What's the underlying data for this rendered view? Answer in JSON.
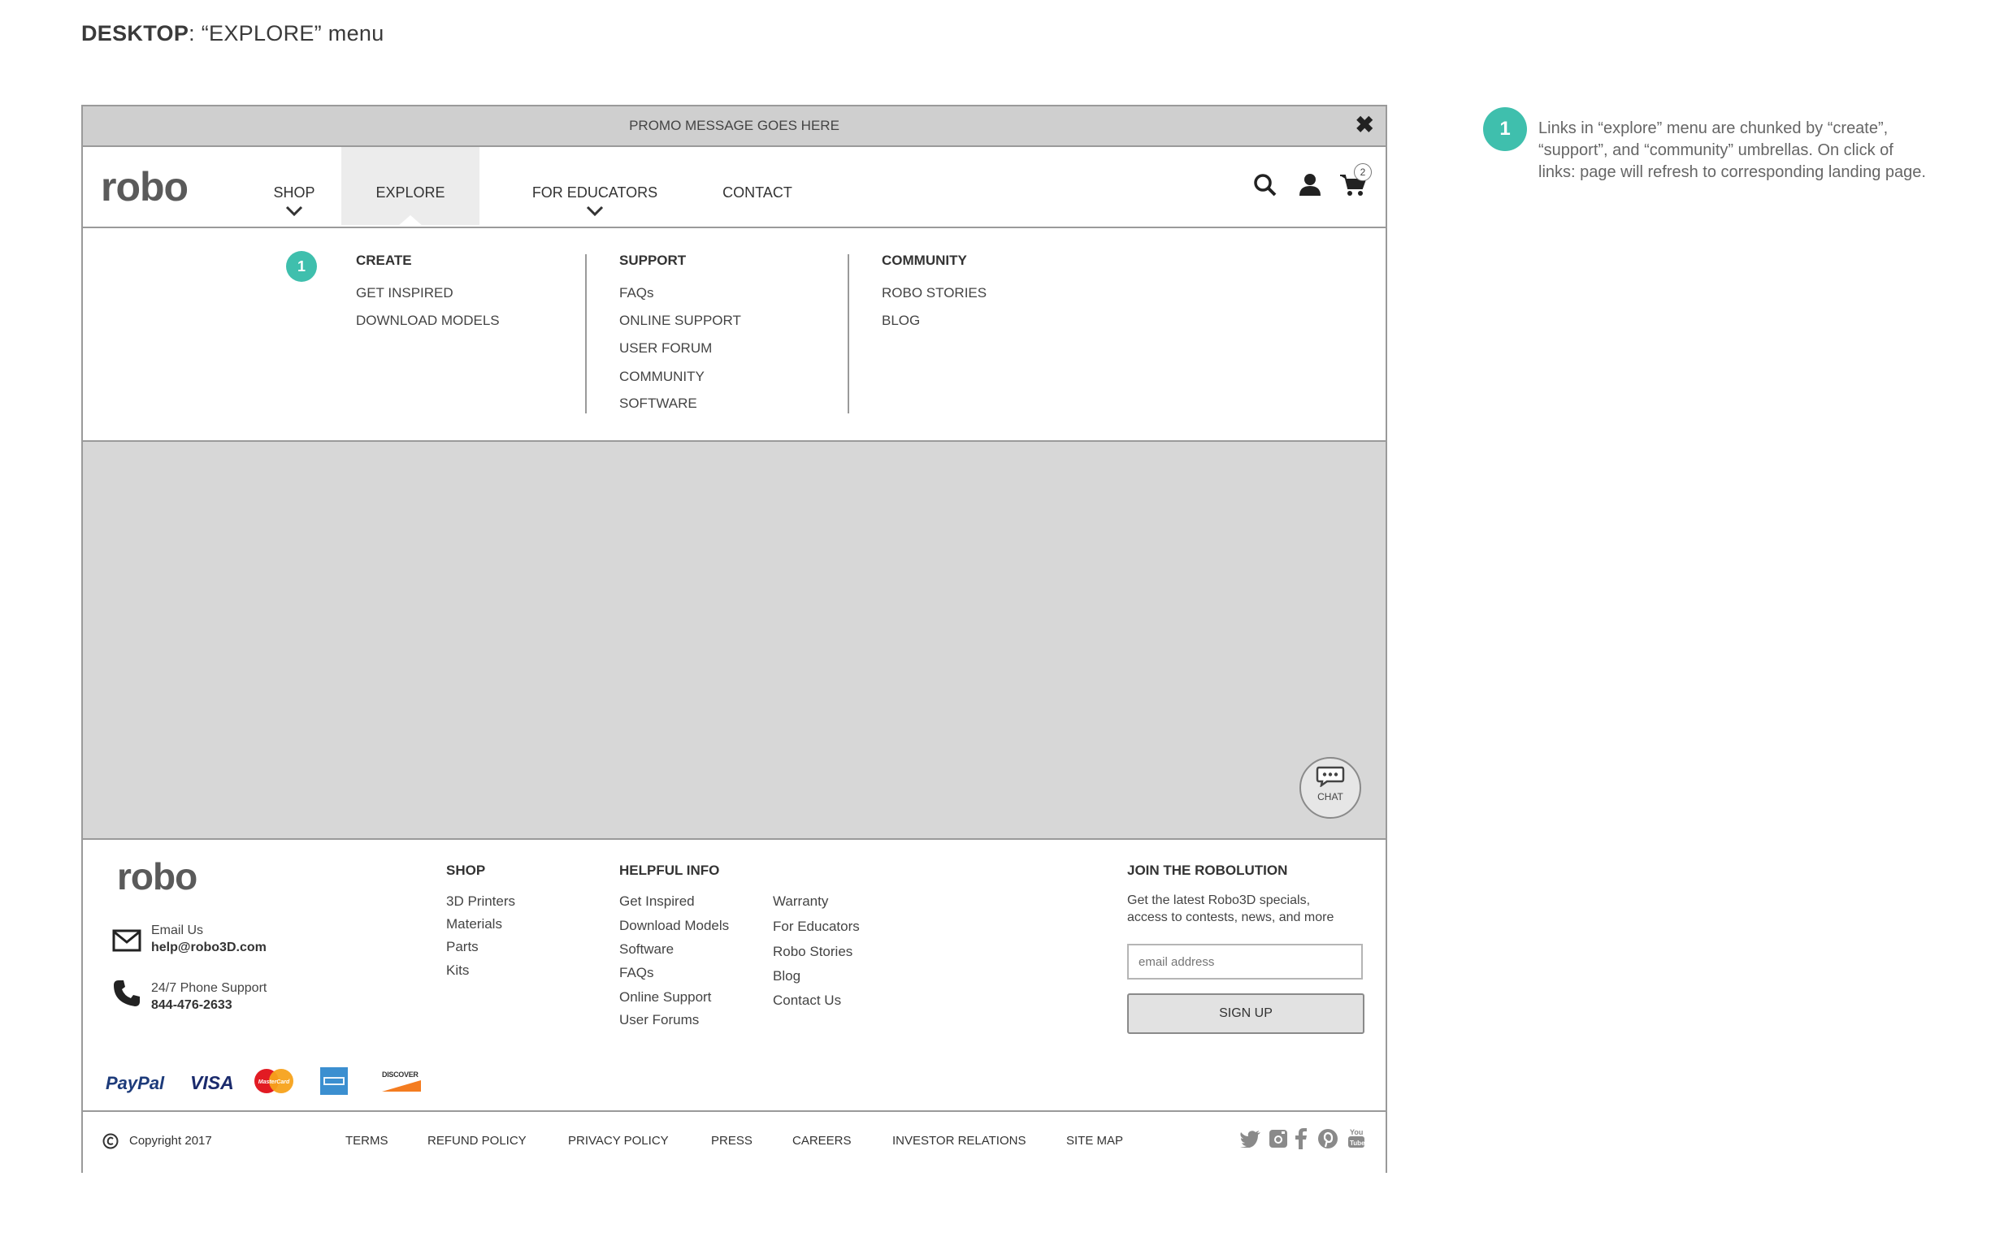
{
  "page": {
    "title_bold": "DESKTOP",
    "title_rest": ": “EXPLORE” menu"
  },
  "promo": {
    "message": "PROMO MESSAGE GOES HERE",
    "close_icon": "close-icon"
  },
  "header": {
    "logo": "robo",
    "nav": [
      {
        "label": "SHOP",
        "has_dropdown": true
      },
      {
        "label": "EXPLORE",
        "active": true
      },
      {
        "label": "FOR EDUCATORS",
        "has_dropdown": true
      },
      {
        "label": "CONTACT"
      }
    ],
    "icons": {
      "search": "search-icon",
      "account": "user-icon",
      "cart": "cart-icon"
    },
    "cart_count": "2"
  },
  "explore_menu": {
    "badge": "1",
    "columns": [
      {
        "heading": "CREATE",
        "links": [
          "GET INSPIRED",
          "DOWNLOAD MODELS"
        ]
      },
      {
        "heading": "SUPPORT",
        "links": [
          "FAQs",
          "ONLINE SUPPORT",
          "USER FORUM",
          "COMMUNITY",
          "SOFTWARE"
        ]
      },
      {
        "heading": "COMMUNITY",
        "links": [
          "ROBO STORIES",
          "BLOG"
        ]
      }
    ]
  },
  "chat": {
    "label": "CHAT",
    "icon": "chat-bubble-icon"
  },
  "footer": {
    "logo": "robo",
    "email_label": "Email Us",
    "email": "help@robo3D.com",
    "phone_label": "24/7 Phone Support",
    "phone": "844-476-2633",
    "shop": {
      "heading": "SHOP",
      "links": [
        "3D Printers",
        "Materials",
        "Parts",
        "Kits"
      ]
    },
    "helpful": {
      "heading": "HELPFUL INFO",
      "links_a": [
        "Get Inspired",
        "Download Models",
        "Software",
        "FAQs",
        "Online Support",
        "User Forums"
      ],
      "links_b": [
        "Warranty",
        "For Educators",
        "Robo Stories",
        "Blog",
        "Contact Us"
      ]
    },
    "join": {
      "heading": "JOIN THE ROBOLUTION",
      "text_line1": "Get the latest Robo3D specials,",
      "text_line2": "access to contests, news, and more",
      "placeholder": "email address",
      "button": "SIGN UP"
    },
    "payments": {
      "paypal": "PayPal",
      "visa": "VISA",
      "mastercard": "MasterCard",
      "discover": "DISCOVER"
    },
    "copyright": "Copyright 2017",
    "bottom_links": [
      "TERMS",
      "REFUND POLICY",
      "PRIVACY POLICY",
      "PRESS",
      "CAREERS",
      "INVESTOR RELATIONS",
      "SITE MAP"
    ],
    "social_icons": [
      "twitter-icon",
      "instagram-icon",
      "facebook-icon",
      "pinterest-icon",
      "youtube-icon"
    ]
  },
  "annotation": {
    "badge": "1",
    "text": "Links in “explore” menu are chunked by “create”, “support”, and “community” umbrellas. On click of links: page will refresh to corresponding landing page."
  },
  "colors": {
    "accent": "#3fbfad",
    "promo_bg": "#cfcfcf",
    "hero_bg": "#d7d7d7"
  }
}
